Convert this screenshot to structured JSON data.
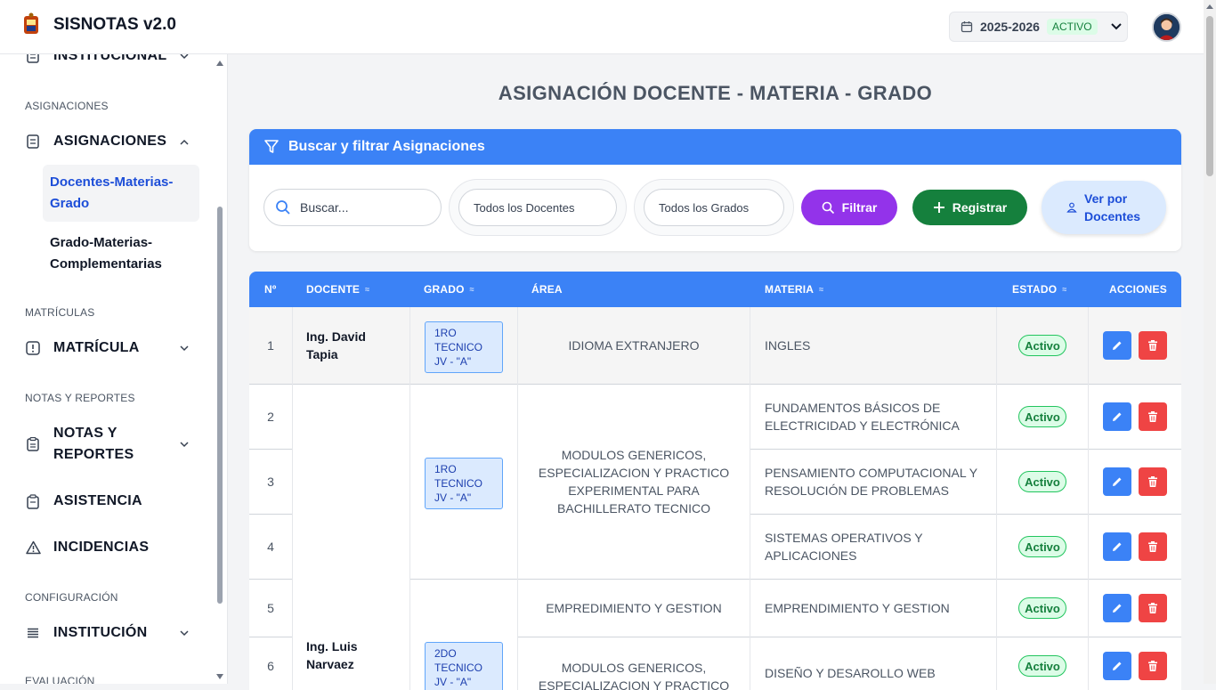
{
  "header": {
    "app_title": "SISNOTAS v2.0",
    "year": "2025-2026",
    "year_status": "ACTIVO"
  },
  "sidebar": {
    "top_cut_label": "INSTITUCIONAL",
    "sections": {
      "asignaciones": "ASIGNACIONES",
      "matriculas": "MATRÍCULAS",
      "notas": "NOTAS Y REPORTES",
      "configuracion": "CONFIGURACIÓN",
      "evaluacion": "EVALUACIÓN"
    },
    "items": {
      "asignaciones": "ASIGNACIONES",
      "docentes_materias": "Docentes-Materias-Grado",
      "grado_materias": "Grado-Materias-Complementarias",
      "matricula": "MATRÍCULA",
      "notas": "NOTAS Y REPORTES",
      "asistencia": "ASISTENCIA",
      "incidencias": "INCIDENCIAS",
      "institucion": "INSTITUCIÓN"
    }
  },
  "page": {
    "title": "ASIGNACIÓN DOCENTE - MATERIA - GRADO"
  },
  "filters": {
    "title": "Buscar y filtrar Asignaciones",
    "search_placeholder": "Buscar...",
    "docentes_select": "Todos los Docentes",
    "grados_select": "Todos los Grados",
    "filtrar_label": "Filtrar",
    "registrar_label": "Registrar",
    "ver_label": "Ver por Docentes"
  },
  "table": {
    "headers": {
      "n": "Nº",
      "docente": "DOCENTE",
      "grado": "GRADO",
      "area": "ÁREA",
      "materia": "MATERIA",
      "estado": "ESTADO",
      "acciones": "ACCIONES"
    },
    "rows": [
      {
        "n": "1",
        "materia": "INGLES",
        "estado": "Activo"
      },
      {
        "n": "2",
        "materia": "FUNDAMENTOS BÁSICOS DE ELECTRICIDAD Y ELECTRÓNICA",
        "estado": "Activo"
      },
      {
        "n": "3",
        "materia": "PENSAMIENTO COMPUTACIONAL Y RESOLUCIÓN DE PROBLEMAS",
        "estado": "Activo"
      },
      {
        "n": "4",
        "materia": "SISTEMAS OPERATIVOS Y APLICACIONES",
        "estado": "Activo"
      },
      {
        "n": "5",
        "materia": "EMPRENDIMIENTO Y GESTION",
        "estado": "Activo"
      },
      {
        "n": "6",
        "materia": "DISEÑO Y DESAROLLO WEB",
        "estado": "Activo"
      }
    ],
    "docentes": [
      "Ing. David Tapia",
      "Ing. Luis Narvaez"
    ],
    "grados": [
      "1RO TECNICO JV - \"A\"",
      "1RO TECNICO JV - \"A\"",
      "2DO TECNICO JV - \"A\""
    ],
    "areas": [
      "IDIOMA EXTRANJERO",
      "MODULOS GENERICOS, ESPECIALIZACION Y PRACTICO EXPERIMENTAL PARA BACHILLERATO TECNICO",
      "EMPREDIMIENTO Y GESTION",
      "MODULOS GENERICOS, ESPECIALIZACION Y PRACTICO"
    ]
  },
  "colors": {
    "primary": "#3b82f6",
    "filter_button": "#9333ea",
    "register_button": "#15803d",
    "delete_button": "#ef4444",
    "active_badge": "#22c55e"
  }
}
